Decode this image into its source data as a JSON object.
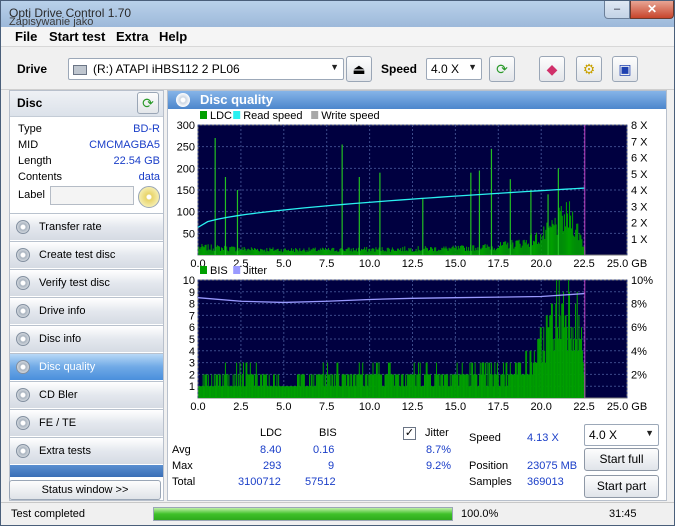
{
  "window": {
    "title": "Opti Drive Control 1.70",
    "subtitle": "Zapisywanie jako"
  },
  "menu": [
    "File",
    "Start test",
    "Extra",
    "Help"
  ],
  "drivebar": {
    "drive_label": "Drive",
    "drive_value": "(R:)   ATAPI iHBS112   2 PL06",
    "speed_label": "Speed",
    "speed_value": "4.0 X"
  },
  "disc": {
    "header": "Disc",
    "rows": [
      {
        "key": "Type",
        "value": "BD-R"
      },
      {
        "key": "MID",
        "value": "CMCMAGBA5"
      },
      {
        "key": "Length",
        "value": "22.54 GB"
      },
      {
        "key": "Contents",
        "value": "data"
      }
    ],
    "label_key": "Label",
    "label_value": ""
  },
  "nav": [
    {
      "label": "Transfer rate",
      "active": false
    },
    {
      "label": "Create test disc",
      "active": false
    },
    {
      "label": "Verify test disc",
      "active": false
    },
    {
      "label": "Drive info",
      "active": false
    },
    {
      "label": "Disc info",
      "active": false
    },
    {
      "label": "Disc quality",
      "active": true
    },
    {
      "label": "CD Bler",
      "active": false
    },
    {
      "label": "FE / TE",
      "active": false
    },
    {
      "label": "Extra tests",
      "active": false
    }
  ],
  "status_window_label": "Status window >>",
  "main": {
    "title": "Disc quality"
  },
  "chart_data": [
    {
      "type": "area",
      "legend": [
        "LDC",
        "Read speed",
        "Write speed"
      ],
      "colors": {
        "LDC": "#00a000",
        "Read speed": "#2af0f0",
        "Write speed": "#a8a8a8"
      },
      "x_ticks": [
        "0.0",
        "2.5",
        "5.0",
        "7.5",
        "10.0",
        "12.5",
        "15.0",
        "17.5",
        "20.0",
        "22.5",
        "25.0 GB"
      ],
      "y_left_ticks": [
        "300",
        "250",
        "200",
        "150",
        "100",
        "50"
      ],
      "y_right_ticks": [
        "8 X",
        "7 X",
        "6 X",
        "5 X",
        "4 X",
        "3 X",
        "2 X",
        "1 X"
      ],
      "xlim": [
        0,
        25
      ],
      "ylim": [
        0,
        300
      ],
      "y2lim": [
        0,
        8
      ],
      "disc_end_gb": 22.54,
      "read_speed_x": [
        0,
        22.54
      ],
      "read_speed_y": [
        1.7,
        4.12
      ],
      "ldc_profile": [
        [
          0,
          18
        ],
        [
          2.5,
          14
        ],
        [
          5,
          12
        ],
        [
          7.5,
          12
        ],
        [
          10,
          13
        ],
        [
          12.5,
          14
        ],
        [
          15,
          15
        ],
        [
          17.5,
          20
        ],
        [
          19,
          30
        ],
        [
          20,
          42
        ],
        [
          21,
          75
        ],
        [
          21.7,
          90
        ],
        [
          22.3,
          40
        ],
        [
          22.54,
          10
        ]
      ],
      "ldc_spikes": [
        [
          1.0,
          270
        ],
        [
          1.6,
          180
        ],
        [
          2.3,
          150
        ],
        [
          8.4,
          255
        ],
        [
          9.4,
          180
        ],
        [
          10.6,
          190
        ],
        [
          13.1,
          130
        ],
        [
          15.9,
          190
        ],
        [
          16.4,
          195
        ],
        [
          17.1,
          245
        ],
        [
          18.2,
          175
        ],
        [
          19.4,
          150
        ],
        [
          20.4,
          140
        ],
        [
          21.0,
          200
        ]
      ]
    },
    {
      "type": "area",
      "legend": [
        "BIS",
        "Jitter"
      ],
      "colors": {
        "BIS": "#00a000",
        "Jitter": "#9a9aff"
      },
      "x_ticks": [
        "0.0",
        "2.5",
        "5.0",
        "7.5",
        "10.0",
        "12.5",
        "15.0",
        "17.5",
        "20.0",
        "22.5",
        "25.0 GB"
      ],
      "y_left_ticks": [
        "10",
        "9",
        "8",
        "7",
        "6",
        "5",
        "4",
        "3",
        "2",
        "1"
      ],
      "y_right_ticks": [
        "10%",
        "8%",
        "6%",
        "4%",
        "2%"
      ],
      "xlim": [
        0,
        25
      ],
      "ylim": [
        0,
        10
      ],
      "y2lim": [
        0,
        10
      ],
      "disc_end_gb": 22.54,
      "bis_profile": [
        [
          0,
          1
        ],
        [
          1.5,
          2
        ],
        [
          3,
          2
        ],
        [
          5,
          1
        ],
        [
          7.5,
          2
        ],
        [
          10,
          2
        ],
        [
          12.5,
          2
        ],
        [
          15,
          2
        ],
        [
          17.5,
          2
        ],
        [
          19.5,
          3
        ],
        [
          20.2,
          5
        ],
        [
          20.8,
          7
        ],
        [
          21.5,
          8
        ],
        [
          22.2,
          6
        ],
        [
          22.54,
          2
        ]
      ],
      "jitter_x": [
        0,
        2.5,
        5,
        7.5,
        10,
        12.5,
        15,
        17.5,
        20,
        22.54
      ],
      "jitter_y": [
        8.5,
        8.2,
        8.1,
        8.2,
        8.35,
        8.45,
        8.5,
        8.55,
        8.6,
        8.85
      ]
    }
  ],
  "stats": {
    "col_ldc": "LDC",
    "col_bis": "BIS",
    "col_jitter": "Jitter",
    "avg_label": "Avg",
    "avg_ldc": "8.40",
    "avg_bis": "0.16",
    "avg_jitter": "8.7%",
    "max_label": "Max",
    "max_ldc": "293",
    "max_bis": "9",
    "max_jitter": "9.2%",
    "total_label": "Total",
    "total_ldc": "3100712",
    "total_bis": "57512",
    "jitter_checked": true,
    "speed_label": "Speed",
    "speed_value": "4.13 X",
    "position_label": "Position",
    "position_value": "23075 MB",
    "samples_label": "Samples",
    "samples_value": "369013",
    "speed_select": "4.0 X",
    "start_full": "Start full",
    "start_part": "Start part"
  },
  "statusbar": {
    "status_text": "Test completed",
    "progress_percent": 100,
    "progress_label": "100.0%",
    "time": "31:45"
  }
}
